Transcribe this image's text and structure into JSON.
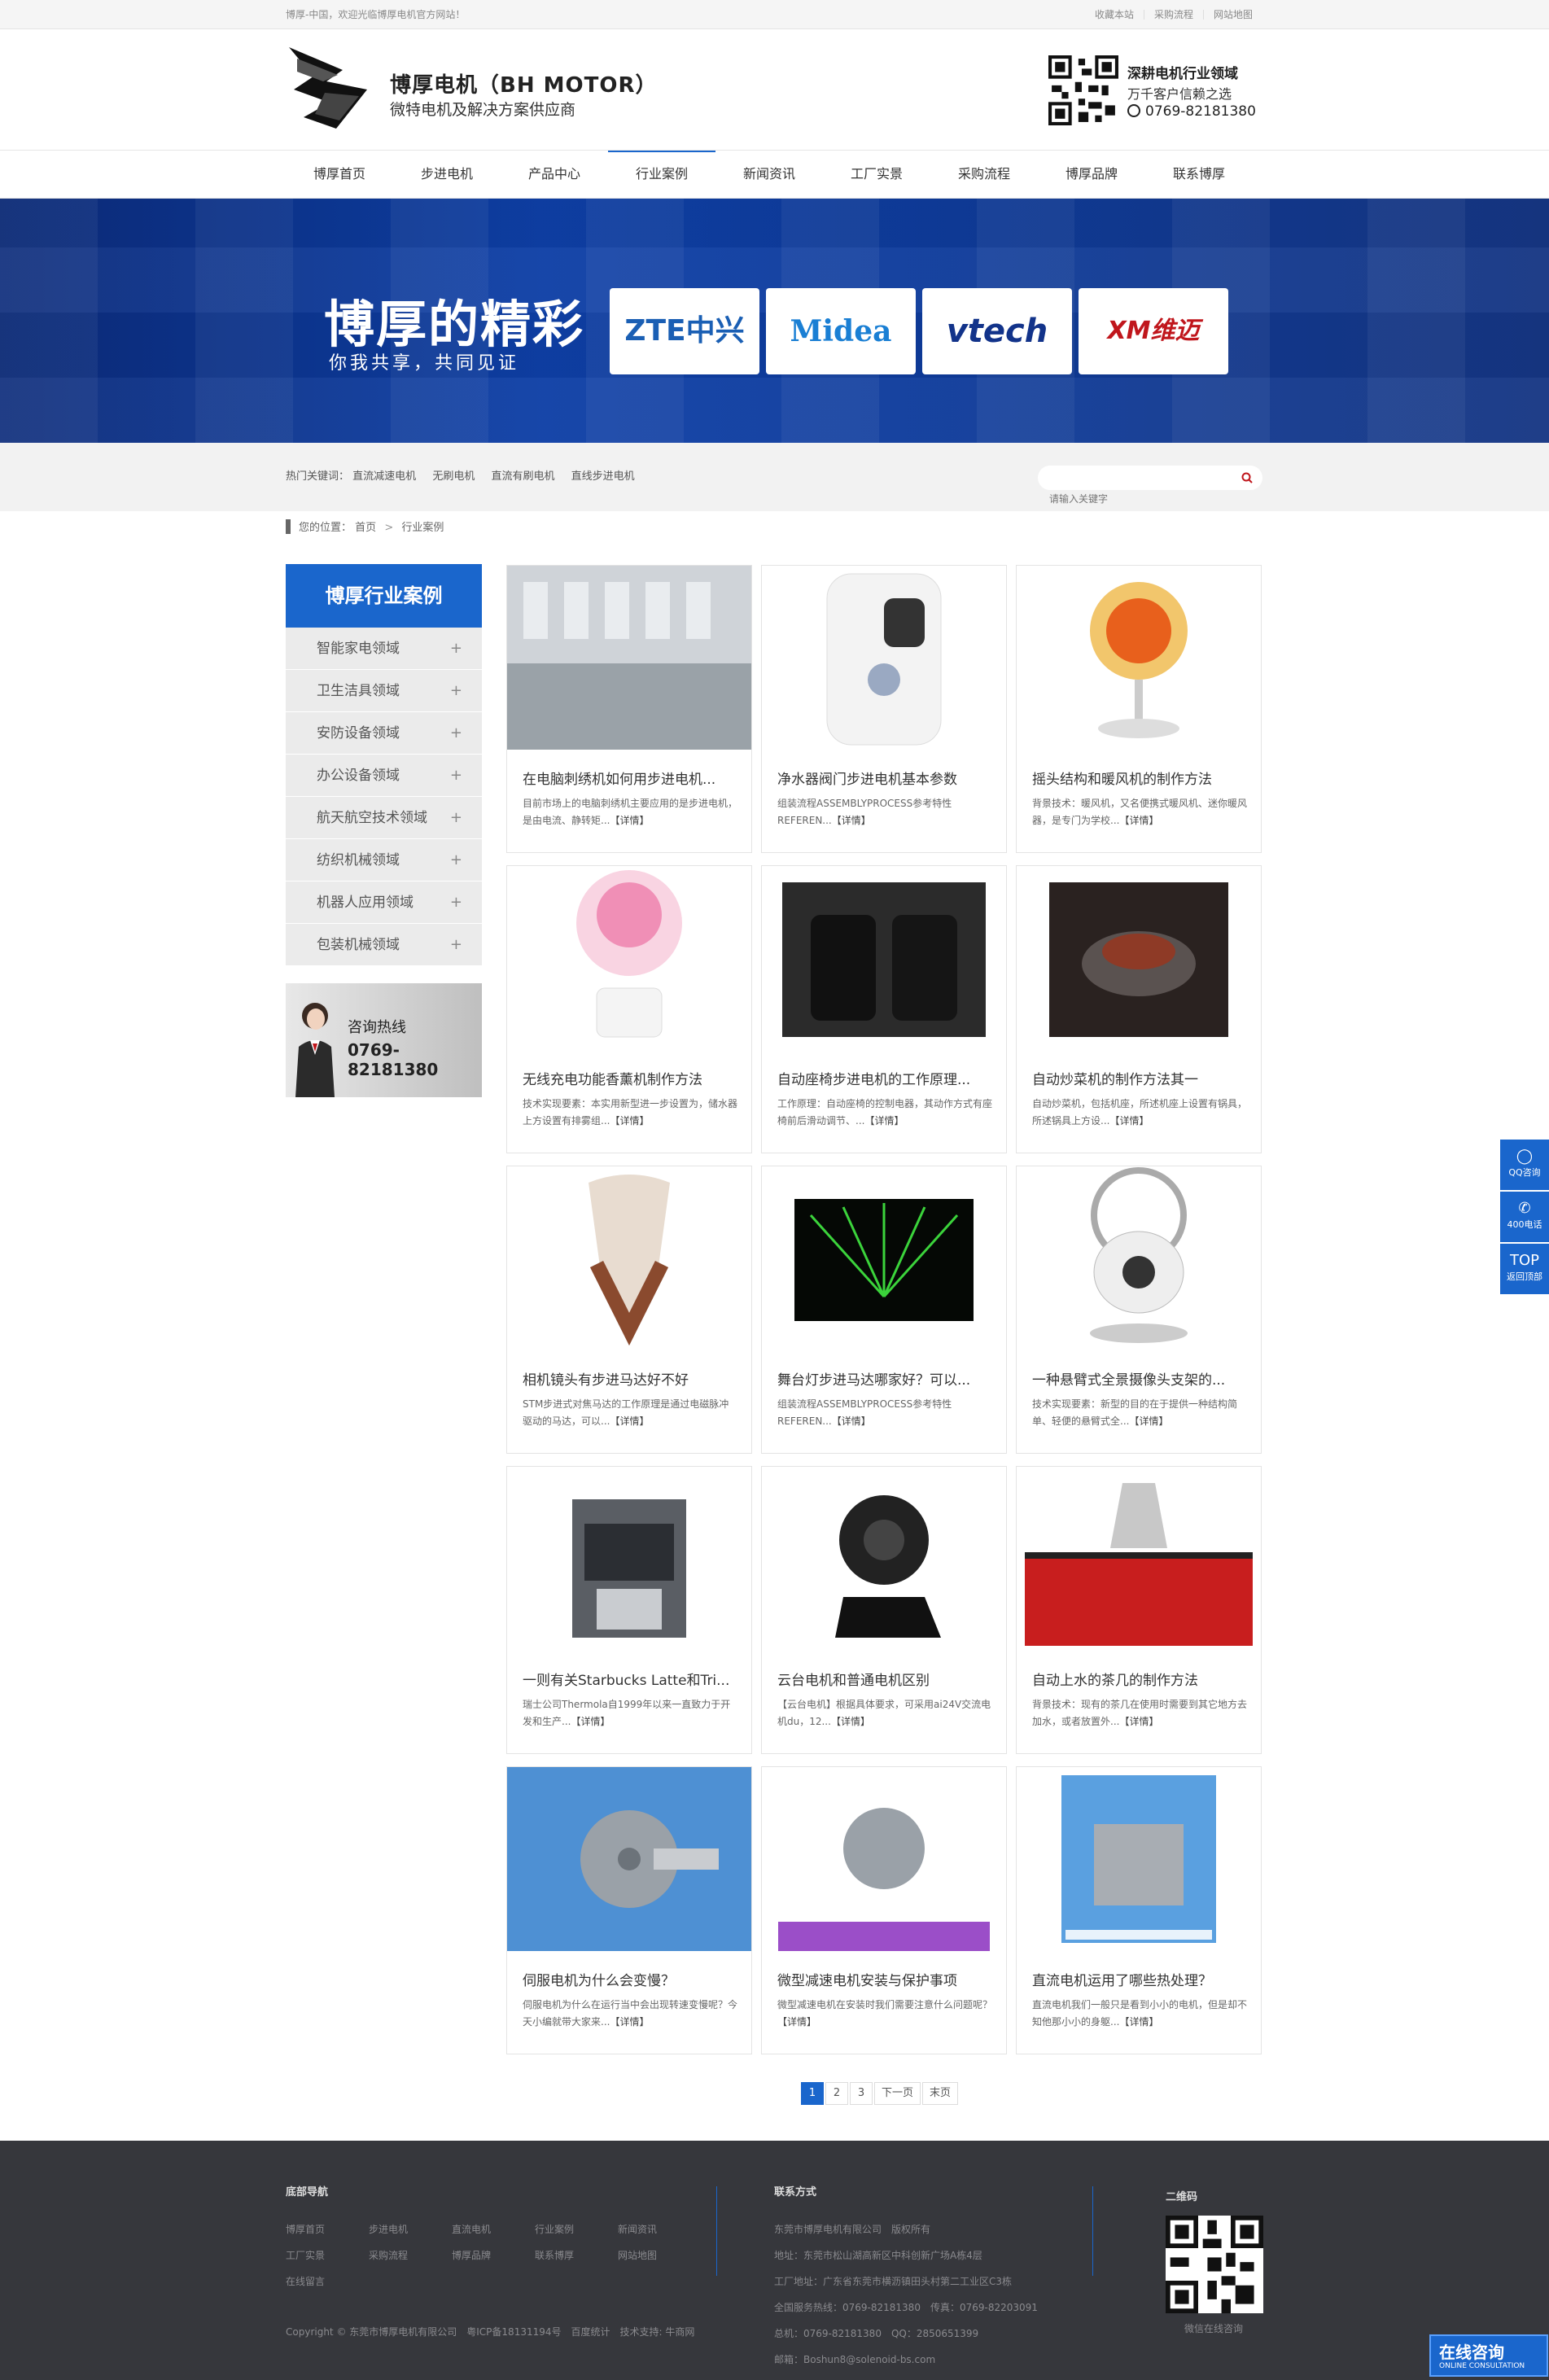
{
  "topbar": {
    "welcome": "博厚-中国，欢迎光临博厚电机官方网站！",
    "links": [
      "收藏本站",
      "采购流程",
      "网站地图"
    ]
  },
  "header": {
    "brand": "博厚电机（BH MOTOR）",
    "subtitle": "微特电机及解决方案供应商",
    "hotline_title": "深耕电机行业领域",
    "hotline_slogan": "万千客户信赖之选",
    "hotline_phone": "0769-82181380"
  },
  "nav": {
    "items": [
      "博厚首页",
      "步进电机",
      "产品中心",
      "行业案例",
      "新闻资讯",
      "工厂实景",
      "采购流程",
      "博厚品牌",
      "联系博厚"
    ],
    "active_index": 3
  },
  "banner": {
    "title": "博厚的精彩",
    "subtitle": "你我共享，共同见证",
    "logos": [
      "ZTE中兴",
      "Midea",
      "vtech",
      "XM维迈"
    ]
  },
  "search": {
    "hot_label": "热门关键词：",
    "keywords": [
      "直流减速电机",
      "无刷电机",
      "直流有刷电机",
      "直线步进电机"
    ],
    "placeholder": "请输入关键字"
  },
  "breadcrumb": {
    "label": "您的位置：",
    "home": "首页",
    "sep": ">",
    "current": "行业案例"
  },
  "sidebar": {
    "title": "博厚行业案例",
    "items": [
      "智能家电领域",
      "卫生洁具领域",
      "安防设备领域",
      "办公设备领域",
      "航天航空技术领域",
      "纺织机械领域",
      "机器人应用领域",
      "包装机械领域"
    ],
    "plus": "+",
    "hotline_label": "咨询热线",
    "hotline_phone": "0769-82181380"
  },
  "cases": [
    {
      "title": "在电脑刺绣机如何用步进电机...",
      "desc": "目前市场上的电脑刺绣机主要应用的是步进电机，是由电流、静转矩...",
      "more": "【详情】"
    },
    {
      "title": "净水器阀门步进电机基本参数",
      "desc": "组装流程ASSEMBLYPROCESS参考特性REFEREN...",
      "more": "【详情】"
    },
    {
      "title": "摇头结构和暖风机的制作方法",
      "desc": "背景技术：暖风机，又名便携式暖风机、迷你暖风器，是专门为学校...",
      "more": "【详情】"
    },
    {
      "title": "无线充电功能香薰机制作方法",
      "desc": "技术实现要素：本实用新型进一步设置为，储水器上方设置有排雾组...",
      "more": "【详情】"
    },
    {
      "title": "自动座椅步进电机的工作原理...",
      "desc": "工作原理：自动座椅的控制电器，其动作方式有座椅前后滑动调节、...",
      "more": "【详情】"
    },
    {
      "title": "自动炒菜机的制作方法其一",
      "desc": "自动炒菜机，包括机座，所述机座上设置有锅具，所述锅具上方设...",
      "more": "【详情】"
    },
    {
      "title": "相机镜头有步进马达好不好",
      "desc": "STM步进式对焦马达的工作原理是通过电磁脉冲驱动的马达，可以...",
      "more": "【详情】"
    },
    {
      "title": "舞台灯步进马达哪家好？可以...",
      "desc": "组装流程ASSEMBLYPROCESS参考特性REFEREN...",
      "more": "【详情】"
    },
    {
      "title": "一种悬臂式全景摄像头支架的...",
      "desc": "技术实现要素：新型的目的在于提供一种结构简单、轻便的悬臂式全...",
      "more": "【详情】"
    },
    {
      "title": "一则有关Starbucks Latte和Tri...",
      "desc": "瑞士公司Thermola自1999年以来一直致力于开发和生产...",
      "more": "【详情】"
    },
    {
      "title": "云台电机和普通电机区别",
      "desc": "【云台电机】根据具体要求，可采用ai24V交流电机du，12...",
      "more": "【详情】"
    },
    {
      "title": "自动上水的茶几的制作方法",
      "desc": "背景技术：现有的茶几在使用时需要到其它地方去加水，或者放置外...",
      "more": "【详情】"
    },
    {
      "title": "伺服电机为什么会变慢？",
      "desc": "伺服电机为什么在运行当中会出现转速变慢呢？今天小编就带大家来...",
      "more": "【详情】"
    },
    {
      "title": "微型减速电机安装与保护事项",
      "desc": "微型减速电机在安装时我们需要注意什么问题呢？",
      "more": "【详情】"
    },
    {
      "title": "直流电机运用了哪些热处理？",
      "desc": "直流电机我们一般只是看到小小的电机，但是却不知他那小小的身躯...",
      "more": "【详情】"
    }
  ],
  "pagination": {
    "pages": [
      "1",
      "2",
      "3"
    ],
    "current": "1",
    "next": "下一页",
    "last": "末页"
  },
  "footer": {
    "nav_title": "底部导航",
    "nav_links": [
      "博厚首页",
      "步进电机",
      "直流电机",
      "行业案例",
      "新闻资讯",
      "工厂实景",
      "采购流程",
      "博厚品牌",
      "联系博厚",
      "网站地图",
      "在线留言"
    ],
    "copyright": "Copyright © 东莞市博厚电机有限公司　粤ICP备18131194号　百度统计　技术支持: 牛商网",
    "contact_title": "联系方式",
    "contact_lines": [
      "东莞市博厚电机有限公司　版权所有",
      "地址：东莞市松山湖高新区中科创新广场A栋4层",
      "工厂地址：广东省东莞市横沥镇田头村第二工业区C3栋",
      "全国服务热线：0769-82181380　传真：0769-82203091",
      "总机：0769-82181380　QQ：2850651399",
      "邮箱：Boshun8@solenoid-bs.com"
    ],
    "qr_title": "二维码",
    "qr_caption": "微信在线咨询"
  },
  "float": {
    "qq": "QQ咨询",
    "phone": "400电话",
    "top_icon": "TOP",
    "top": "返回顶部"
  },
  "consult": {
    "title": "在线咨询",
    "sub": "ONLINE CONSULTATION"
  },
  "colors": {
    "accent": "#1a66cc",
    "footer": "#36373c"
  }
}
